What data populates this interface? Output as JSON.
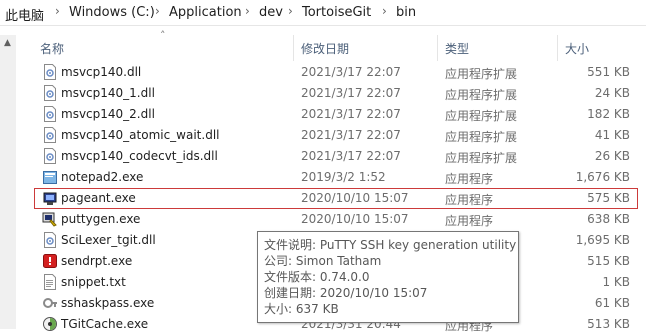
{
  "breadcrumb": [
    "此电脑",
    "Windows (C:)",
    "Application",
    "dev",
    "TortoiseGit",
    "bin"
  ],
  "columns": {
    "name": "名称",
    "date": "修改日期",
    "type": "类型",
    "size": "大小"
  },
  "files": [
    {
      "name": "msvcp140.dll",
      "date": "2021/3/17 22:07",
      "type": "应用程序扩展",
      "size": "551 KB",
      "icon": "dll-file-icon"
    },
    {
      "name": "msvcp140_1.dll",
      "date": "2021/3/17 22:07",
      "type": "应用程序扩展",
      "size": "24 KB",
      "icon": "dll-file-icon"
    },
    {
      "name": "msvcp140_2.dll",
      "date": "2021/3/17 22:07",
      "type": "应用程序扩展",
      "size": "182 KB",
      "icon": "dll-file-icon"
    },
    {
      "name": "msvcp140_atomic_wait.dll",
      "date": "2021/3/17 22:07",
      "type": "应用程序扩展",
      "size": "41 KB",
      "icon": "dll-file-icon"
    },
    {
      "name": "msvcp140_codecvt_ids.dll",
      "date": "2021/3/17 22:07",
      "type": "应用程序扩展",
      "size": "26 KB",
      "icon": "dll-file-icon"
    },
    {
      "name": "notepad2.exe",
      "date": "2019/3/2 1:52",
      "type": "应用程序",
      "size": "1,676 KB",
      "icon": "notepad2-app-icon"
    },
    {
      "name": "pageant.exe",
      "date": "2020/10/10 15:07",
      "type": "应用程序",
      "size": "575 KB",
      "icon": "pageant-app-icon"
    },
    {
      "name": "puttygen.exe",
      "date": "2020/10/10 15:07",
      "type": "应用程序",
      "size": "638 KB",
      "icon": "puttygen-app-icon"
    },
    {
      "name": "SciLexer_tgit.dll",
      "date": "",
      "type": "",
      "size": "1,695 KB",
      "icon": "dll-file-icon"
    },
    {
      "name": "sendrpt.exe",
      "date": "",
      "type": "",
      "size": "515 KB",
      "icon": "sendrpt-app-icon"
    },
    {
      "name": "snippet.txt",
      "date": "",
      "type": "",
      "size": "1 KB",
      "icon": "text-file-icon"
    },
    {
      "name": "sshaskpass.exe",
      "date": "",
      "type": "",
      "size": "61 KB",
      "icon": "sshaskpass-app-icon"
    },
    {
      "name": "TGitCache.exe",
      "date": "2021/3/31 20:44",
      "type": "应用程序",
      "size": "513 KB",
      "icon": "tgitcache-app-icon"
    }
  ],
  "tooltip": {
    "desc": "文件说明: PuTTY SSH key generation utility",
    "company": "公司: Simon Tatham",
    "version": "文件版本: 0.74.0.0",
    "created": "创建日期: 2020/10/10 15:07",
    "size": "大小: 637 KB"
  },
  "colors": {
    "selection_border": "#cc3a3a",
    "header_text": "#4c607a"
  }
}
